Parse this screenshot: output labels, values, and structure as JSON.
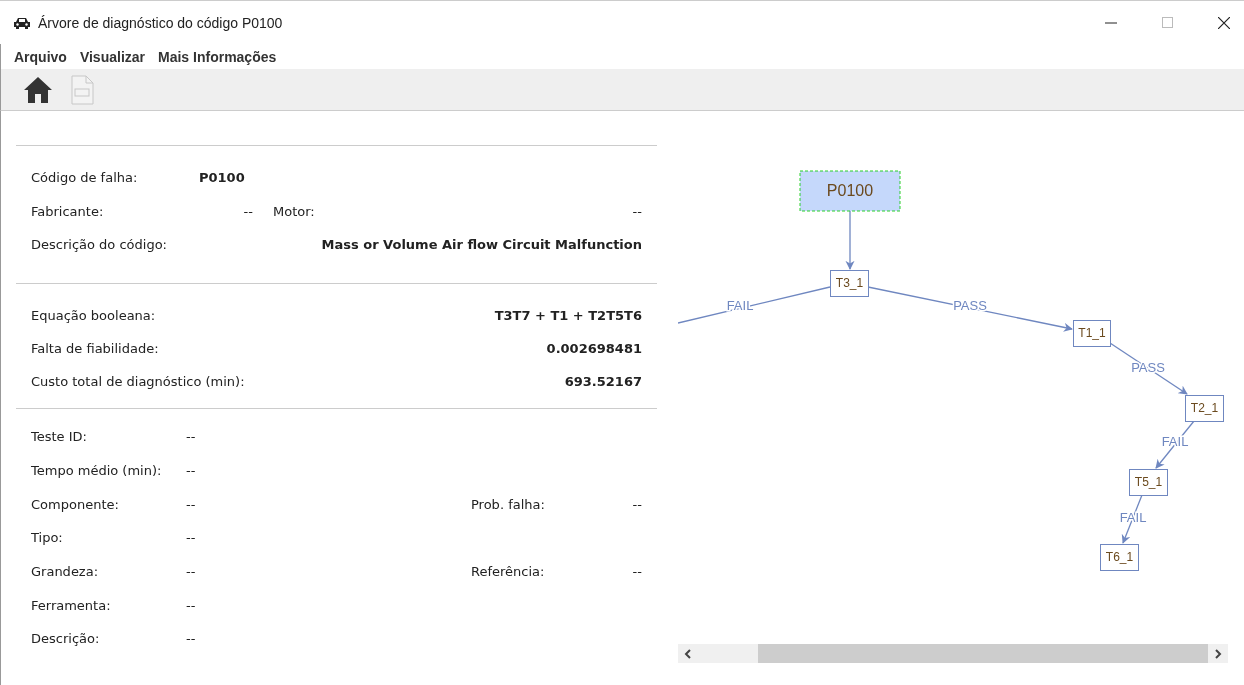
{
  "window": {
    "title": "Árvore de diagnóstico do código P0100"
  },
  "menu": [
    "Arquivo",
    "Visualizar",
    "Mais Informações"
  ],
  "toolbar": [
    {
      "kind": "home",
      "disabled": false
    },
    {
      "kind": "xml",
      "disabled": true
    }
  ],
  "code_section": {
    "fault_code_label": "Código de falha:",
    "fault_code": "P0100",
    "manufacturer_label": "Fabricante:",
    "manufacturer": "--",
    "engine_label": "Motor:",
    "engine": "--",
    "description_label": "Descrição do código:",
    "description": "Mass or Volume Air flow Circuit Malfunction"
  },
  "summary_section": [
    {
      "label": "Equação booleana:",
      "value": "T3T7 + T1 + T2T5T6"
    },
    {
      "label": "Falta de fiabilidade:",
      "value": "0.002698481"
    },
    {
      "label": "Custo total de diagnóstico (min):",
      "value": "693.52167"
    }
  ],
  "test_section": [
    {
      "label": "Teste ID:",
      "value": "--"
    },
    {
      "label": "Tempo médio (min):",
      "value": "--"
    },
    {
      "label": "Componente:",
      "value": "--",
      "extra_label": "Prob. falha:",
      "extra_value": "--"
    },
    {
      "label": "Tipo:",
      "value": "--"
    },
    {
      "label": "Grandeza:",
      "value": "--",
      "extra_label": "Referência:",
      "extra_value": "--"
    },
    {
      "label": "Ferramenta:",
      "value": "--"
    },
    {
      "label": "Descrição:",
      "value": "--"
    }
  ],
  "diagram": {
    "nodes": [
      {
        "label": "P0100",
        "kind": "root"
      },
      {
        "label": "T3_1",
        "kind": "test"
      },
      {
        "label": "T1_1",
        "kind": "test"
      },
      {
        "label": "T2_1",
        "kind": "test"
      },
      {
        "label": "T5_1",
        "kind": "test"
      },
      {
        "label": "T6_1",
        "kind": "test"
      }
    ],
    "edges": [
      {
        "label": "FAIL"
      },
      {
        "label": "PASS"
      },
      {
        "label": "PASS"
      },
      {
        "label": "FAIL"
      },
      {
        "label": "FAIL"
      }
    ]
  }
}
